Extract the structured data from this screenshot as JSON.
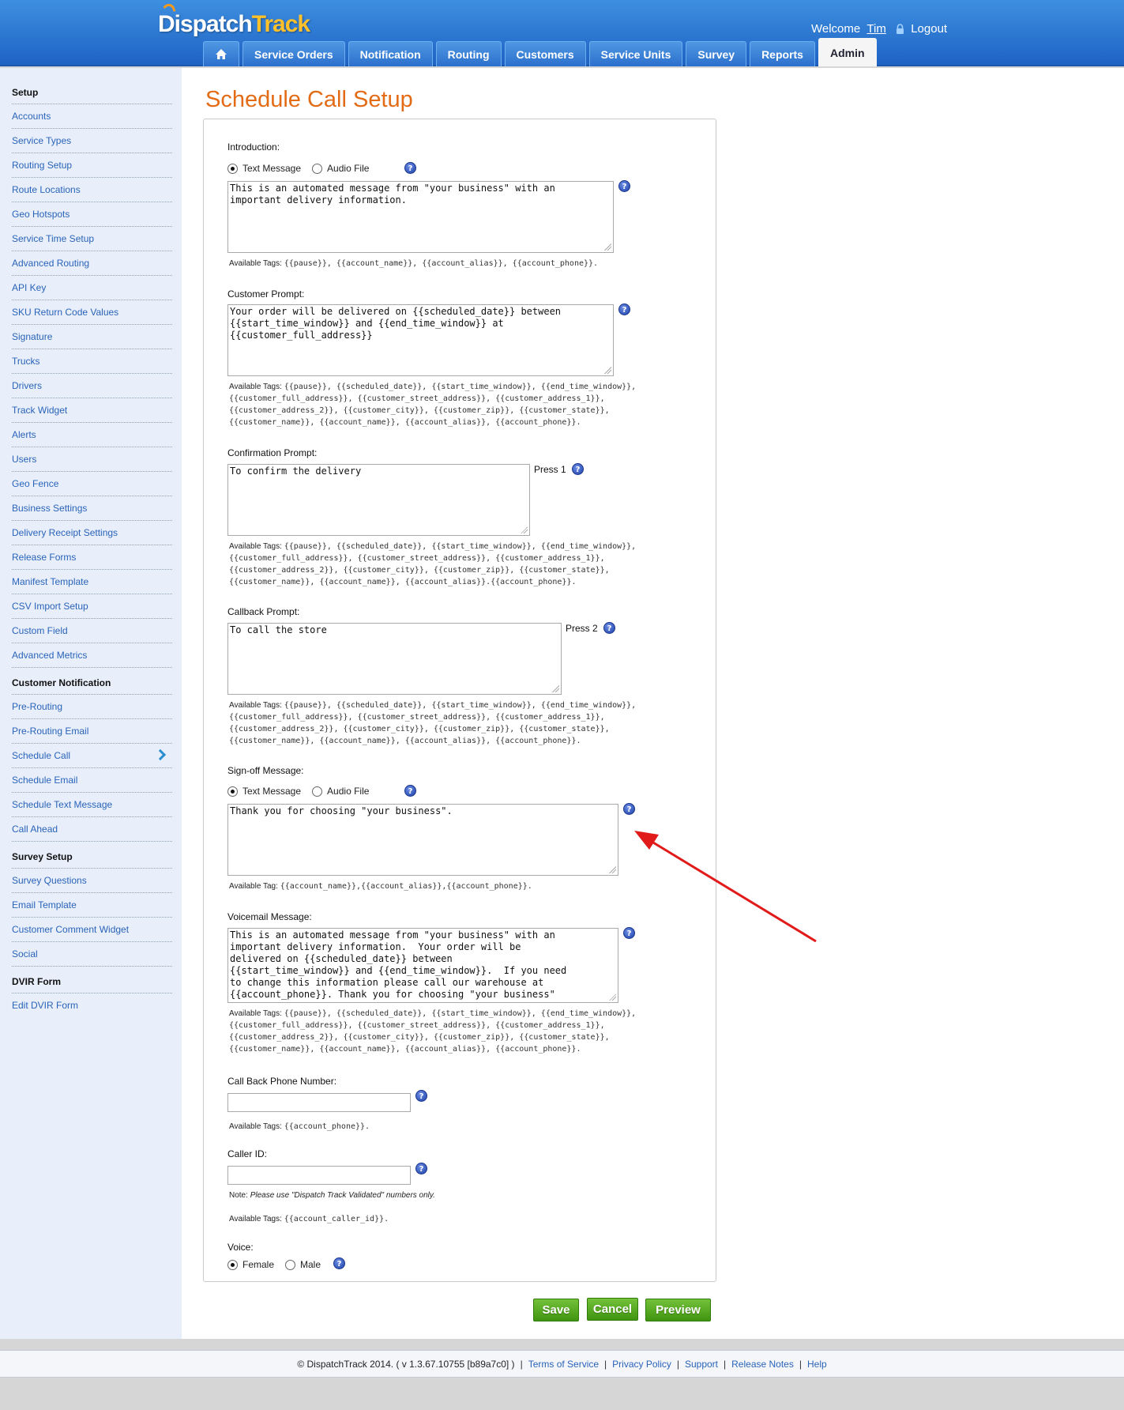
{
  "header": {
    "logo_dispatch": "Dispatch",
    "logo_track": "Track",
    "welcome": "Welcome",
    "user": "Tim",
    "logout": "Logout",
    "tabs": [
      "Service Orders",
      "Notification",
      "Routing",
      "Customers",
      "Service Units",
      "Survey",
      "Reports",
      "Admin"
    ],
    "active_tab": "Admin"
  },
  "sidebar": {
    "sections": [
      {
        "title": "Setup",
        "items": [
          "Accounts",
          "Service Types",
          "Routing Setup",
          "Route Locations",
          "Geo Hotspots",
          "Service Time Setup",
          "Advanced Routing",
          "API Key",
          "SKU Return Code Values",
          "Signature",
          "Trucks",
          "Drivers",
          "Track Widget",
          "Alerts",
          "Users",
          "Geo Fence",
          "Business Settings",
          "Delivery Receipt Settings",
          "Release Forms",
          "Manifest Template",
          "CSV Import Setup",
          "Custom Field",
          "Advanced Metrics"
        ]
      },
      {
        "title": "Customer Notification",
        "items": [
          "Pre-Routing",
          "Pre-Routing Email",
          "Schedule Call",
          "Schedule Email",
          "Schedule Text Message",
          "Call Ahead"
        ]
      },
      {
        "title": "Survey Setup",
        "items": [
          "Survey Questions",
          "Email Template",
          "Customer Comment Widget",
          "Social"
        ]
      },
      {
        "title": "DVIR Form",
        "items": [
          "Edit DVIR Form"
        ]
      }
    ],
    "selected": "Schedule Call"
  },
  "page": {
    "title": "Schedule Call Setup"
  },
  "form": {
    "introduction": {
      "label": "Introduction:",
      "opt_text": "Text Message",
      "opt_audio": "Audio File",
      "text": "This is an automated message from \"your business\" with an\nimportant delivery information.",
      "tags_label": "Available Tags:",
      "tags": "{{pause}}, {{account_name}}, {{account_alias}}, {{account_phone}}."
    },
    "customer_prompt": {
      "label": "Customer Prompt:",
      "text": "Your order will be delivered on {{scheduled_date}} between\n{{start_time_window}} and {{end_time_window}} at\n{{customer_full_address}}",
      "tags_label": "Available Tags:",
      "tags": "{{pause}}, {{scheduled_date}}, {{start_time_window}}, {{end_time_window}},\n{{customer_full_address}}, {{customer_street_address}}, {{customer_address_1}},\n{{customer_address_2}}, {{customer_city}}, {{customer_zip}}, {{customer_state}},\n{{customer_name}}, {{account_name}}, {{account_alias}}, {{account_phone}}."
    },
    "confirmation_prompt": {
      "label": "Confirmation Prompt:",
      "text": "To confirm the delivery",
      "press": "Press 1",
      "tags_label": "Available Tags:",
      "tags": "{{pause}}, {{scheduled_date}}, {{start_time_window}}, {{end_time_window}},\n{{customer_full_address}}, {{customer_street_address}}, {{customer_address_1}},\n{{customer_address_2}}, {{customer_city}}, {{customer_zip}}, {{customer_state}},\n{{customer_name}}, {{account_name}}, {{account_alias}}.{{account_phone}}."
    },
    "callback_prompt": {
      "label": "Callback Prompt:",
      "text": "To call the store",
      "press": "Press 2",
      "tags_label": "Available Tags:",
      "tags": "{{pause}}, {{scheduled_date}}, {{start_time_window}}, {{end_time_window}},\n{{customer_full_address}}, {{customer_street_address}}, {{customer_address_1}},\n{{customer_address_2}}, {{customer_city}}, {{customer_zip}}, {{customer_state}},\n{{customer_name}}, {{account_name}}, {{account_alias}}, {{account_phone}}."
    },
    "signoff": {
      "label": "Sign-off Message:",
      "opt_text": "Text Message",
      "opt_audio": "Audio File",
      "text": "Thank you for choosing \"your business\".",
      "tags_label": "Available Tag:",
      "tags": "{{account_name}},{{account_alias}},{{account_phone}}."
    },
    "voicemail": {
      "label": "Voicemail Message:",
      "text": "This is an automated message from \"your business\" with an\nimportant delivery information.  Your order will be\ndelivered on {{scheduled_date}} between\n{{start_time_window}} and {{end_time_window}}.  If you need\nto change this information please call our warehouse at\n{{account_phone}}. Thank you for choosing \"your business\"",
      "tags_label": "Available Tags:",
      "tags": "{{pause}}, {{scheduled_date}}, {{start_time_window}}, {{end_time_window}},\n{{customer_full_address}}, {{customer_street_address}}, {{customer_address_1}},\n{{customer_address_2}}, {{customer_city}}, {{customer_zip}}, {{customer_state}},\n{{customer_name}}, {{account_name}}, {{account_alias}}, {{account_phone}}."
    },
    "callback_phone": {
      "label": "Call Back Phone Number:",
      "value": "",
      "tags_label": "Available Tags:",
      "tags": "{{account_phone}}."
    },
    "caller_id": {
      "label": "Caller ID:",
      "value": "",
      "note_label": "Note:",
      "note": "Please use \"Dispatch Track Validated\" numbers only.",
      "tags_label": "Available Tags:",
      "tags": "{{account_caller_id}}."
    },
    "voice": {
      "label": "Voice:",
      "opt_female": "Female",
      "opt_male": "Male",
      "selected": "Female"
    }
  },
  "buttons": {
    "save": "Save",
    "cancel": "Cancel",
    "preview": "Preview"
  },
  "footer": {
    "copyright": "© DispatchTrack 2014.  ( v 1.3.67.10755 [b89a7c0] )",
    "links": [
      "Terms of Service",
      "Privacy Policy",
      "Support",
      "Release Notes",
      "Help"
    ]
  },
  "colors": {
    "header_blue": "#2c6fcd",
    "title_orange": "#e36b16",
    "link_blue": "#2a63b8",
    "button_green": "#4fa31c",
    "annotation_red": "#e11a1a"
  }
}
